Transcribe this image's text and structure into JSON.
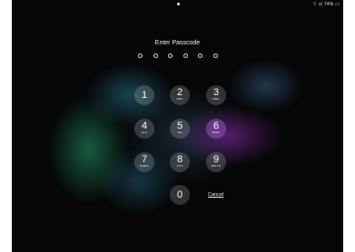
{
  "status_bar": {
    "right": "⌔ ⊙ 74% ▭"
  },
  "passcode": {
    "title": "Enter Passcode",
    "dots": 6
  },
  "keypad": [
    {
      "digit": "1",
      "letters": ""
    },
    {
      "digit": "2",
      "letters": "ABC"
    },
    {
      "digit": "3",
      "letters": "DEF"
    },
    {
      "digit": "4",
      "letters": "GHI"
    },
    {
      "digit": "5",
      "letters": "JKL"
    },
    {
      "digit": "6",
      "letters": "MNO"
    },
    {
      "digit": "7",
      "letters": "PQRS"
    },
    {
      "digit": "8",
      "letters": "TUV"
    },
    {
      "digit": "9",
      "letters": "WXYZ"
    },
    {
      "digit": "0",
      "letters": ""
    }
  ],
  "cancel_label": "Cancel"
}
